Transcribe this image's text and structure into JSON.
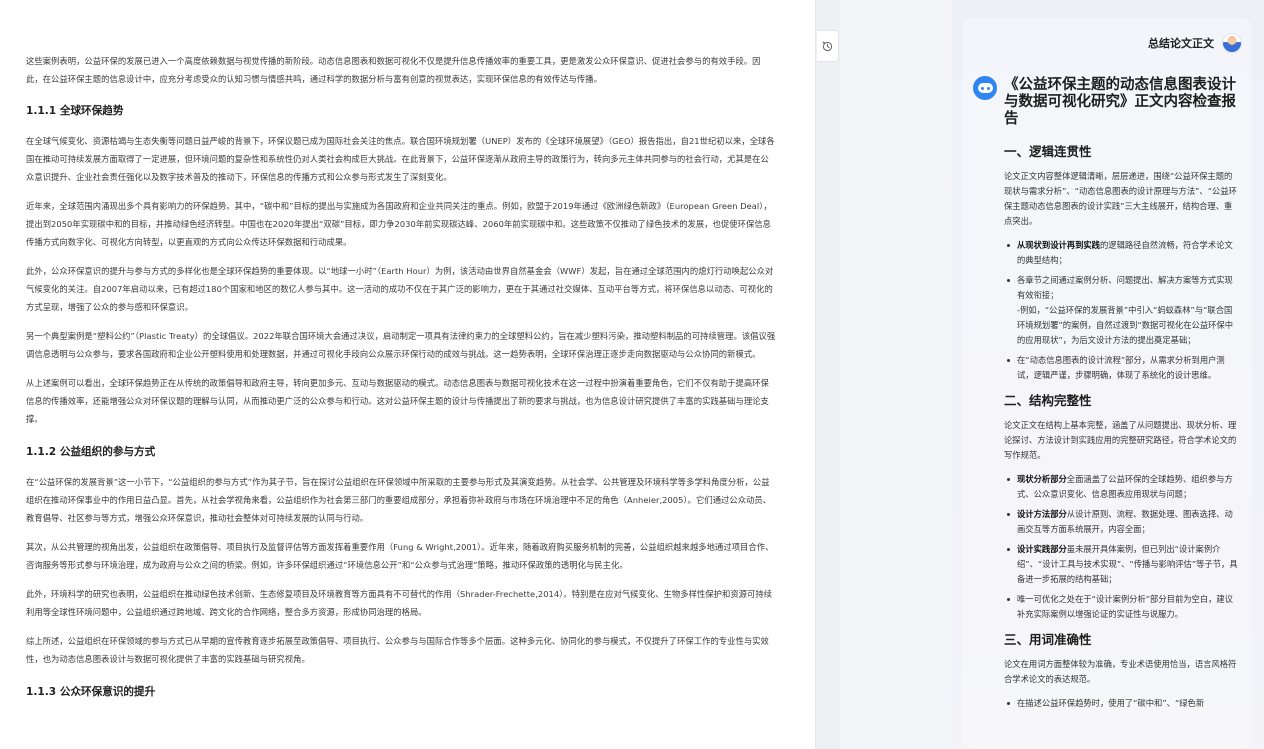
{
  "document": {
    "intro_paragraph": "这些案例表明，公益环保的发展已进入一个高度依赖数据与视觉传播的新阶段。动态信息图表和数据可视化不仅是提升信息传播效率的重要工具，更是激发公众环保意识、促进社会参与的有效手段。因此，在公益环保主题的信息设计中，应充分考虑受众的认知习惯与情感共鸣，通过科学的数据分析与富有创意的视觉表达，实现环保信息的有效传达与传播。",
    "section_111_title": "1.1.1 全球环保趋势",
    "section_111_p1": "在全球气候变化、资源枯竭与生态失衡等问题日益严峻的背景下，环保议题已成为国际社会关注的焦点。联合国环境规划署（UNEP）发布的《全球环境展望》（GEO）报告指出，自21世纪初以来，全球各国在推动可持续发展方面取得了一定进展，但环境问题的复杂性和系统性仍对人类社会构成巨大挑战。在此背景下，公益环保逐渐从政府主导的政策行为，转向多元主体共同参与的社会行动，尤其是在公众意识提升、企业社会责任强化以及数字技术普及的推动下，环保信息的传播方式和公众参与形式发生了深刻变化。",
    "section_111_p2": "近年来，全球范围内涌现出多个具有影响力的环保趋势。其中，“碳中和”目标的提出与实施成为各国政府和企业共同关注的重点。例如，欧盟于2019年通过《欧洲绿色新政》（European Green Deal），提出到2050年实现碳中和的目标，并推动绿色经济转型。中国也在2020年提出“双碳”目标，即力争2030年前实现碳达峰、2060年前实现碳中和。这些政策不仅推动了绿色技术的发展，也促使环保信息传播方式向数字化、可视化方向转型，以更直观的方式向公众传达环保数据和行动成果。",
    "section_111_p3": "此外，公众环保意识的提升与参与方式的多样化也是全球环保趋势的重要体现。以“地球一小时”（Earth Hour）为例，该活动由世界自然基金会（WWF）发起，旨在通过全球范围内的熄灯行动唤起公众对气候变化的关注。自2007年启动以来，已有超过180个国家和地区的数亿人参与其中。这一活动的成功不仅在于其广泛的影响力，更在于其通过社交媒体、互动平台等方式，将环保信息以动态、可视化的方式呈现，增强了公众的参与感和环保意识。",
    "section_111_p4": "另一个典型案例是“塑料公约”（Plastic Treaty）的全球倡议。2022年联合国环境大会通过决议，启动制定一项具有法律约束力的全球塑料公约，旨在减少塑料污染，推动塑料制品的可持续管理。该倡议强调信息透明与公众参与，要求各国政府和企业公开塑料使用和处理数据，并通过可视化手段向公众展示环保行动的成效与挑战。这一趋势表明，全球环保治理正逐步走向数据驱动与公众协同的新模式。",
    "section_111_p5": "从上述案例可以看出，全球环保趋势正在从传统的政策倡导和政府主导，转向更加多元、互动与数据驱动的模式。动态信息图表与数据可视化技术在这一过程中扮演着重要角色，它们不仅有助于提高环保信息的传播效率，还能增强公众对环保议题的理解与认同，从而推动更广泛的公众参与和行动。这对公益环保主题的设计与传播提出了新的要求与挑战，也为信息设计研究提供了丰富的实践基础与理论支撑。",
    "section_112_title": "1.1.2 公益组织的参与方式",
    "section_112_p1": "在“公益环保的发展背景”这一小节下，“公益组织的参与方式”作为其子节，旨在探讨公益组织在环保领域中所采取的主要参与形式及其演变趋势。从社会学、公共管理及环境科学等多学科角度分析，公益组织在推动环保事业中的作用日益凸显。首先，从社会学视角来看，公益组织作为社会第三部门的重要组成部分，承担着弥补政府与市场在环境治理中不足的角色（Anheier,2005）。它们通过公众动员、教育倡导、社区参与等方式，增强公众环保意识，推动社会整体对可持续发展的认同与行动。",
    "section_112_p2": "其次，从公共管理的视角出发，公益组织在政策倡导、项目执行及监督评估等方面发挥着重要作用（Fung & Wright,2001）。近年来，随着政府购买服务机制的完善，公益组织越来越多地通过项目合作、咨询服务等形式参与环境治理，成为政府与公众之间的桥梁。例如，许多环保组织通过“环境信息公开”和“公众参与式治理”策略，推动环保政策的透明化与民主化。",
    "section_112_p3": "此外，环境科学的研究也表明，公益组织在推动绿色技术创新、生态修复项目及环境教育等方面具有不可替代的作用（Shrader-Frechette,2014）。特别是在应对气候变化、生物多样性保护和资源可持续利用等全球性环境问题中，公益组织通过跨地域、跨文化的合作网络，整合多方资源，形成协同治理的格局。",
    "section_112_p4": "综上所述，公益组织在环保领域的参与方式已从早期的宣传教育逐步拓展至政策倡导、项目执行、公众参与与国际合作等多个层面。这种多元化、协同化的参与模式，不仅提升了环保工作的专业性与实效性，也为动态信息图表设计与数据可视化提供了丰富的实践基础与研究视角。",
    "section_113_title": "1.1.3 公众环保意识的提升"
  },
  "panel": {
    "header_title": "总结论文正文",
    "report_title": "《公益环保主题的动态信息图表设计与数据可视化研究》正文内容检查报告",
    "s1_title": "一、逻辑连贯性",
    "s1_para": "论文正文内容整体逻辑清晰，层层递进，围绕“公益环保主题的现状与需求分析”、“动态信息图表的设计原理与方法”、“公益环保主题动态信息图表的设计实践”三大主线展开，结构合理、重点突出。",
    "s1_b1_bold": "从现状到设计再到实践",
    "s1_b1_rest": "的逻辑路径自然流畅，符合学术论文的典型结构；",
    "s1_b2_line1": "各章节之间通过案例分析、问题提出、解决方案等方式实现有效衔接；",
    "s1_b2_line2": "-例如，“公益环保的发展背景”中引入“蚂蚁森林”与“联合国环境规划署”的案例，自然过渡到“数据可视化在公益环保中的应用现状”，为后文设计方法的提出奠定基础；",
    "s1_b3": "在“动态信息图表的设计流程”部分，从需求分析到用户测试，逻辑严谨，步骤明确，体现了系统化的设计思维。",
    "s2_title": "二、结构完整性",
    "s2_para": "论文正文在结构上基本完整，涵盖了从问题提出、现状分析、理论探讨、方法设计到实践应用的完整研究路径，符合学术论文的写作规范。",
    "s2_b1_bold": "现状分析部分",
    "s2_b1_rest": "全面涵盖了公益环保的全球趋势、组织参与方式、公众意识变化、信息图表应用现状与问题；",
    "s2_b2_bold": "设计方法部分",
    "s2_b2_rest": "从设计原则、流程、数据处理、图表选择、动画交互等方面系统展开，内容全面；",
    "s2_b3_bold": "设计实践部分",
    "s2_b3_rest": "虽未展开具体案例，但已列出“设计案例介绍”、“设计工具与技术实现”、“传播与影响评估”等子节，具备进一步拓展的结构基础；",
    "s2_b4": "唯一可优化之处在于“设计案例分析”部分目前为空白，建议补充实际案例以增强论证的实证性与说服力。",
    "s3_title": "三、用词准确性",
    "s3_para": "论文在用词方面整体较为准确，专业术语使用恰当，语言风格符合学术论文的表达规范。",
    "s3_b1": "在描述公益环保趋势时，使用了“碳中和”、“绿色新"
  },
  "icons": {
    "history": "history-clock-icon",
    "bot": "ai-bot-icon",
    "avatar": "user-avatar"
  },
  "colors": {
    "accent": "#2f86f0",
    "doc_background": "#ffffff",
    "panel_background": "#eef0f8"
  }
}
